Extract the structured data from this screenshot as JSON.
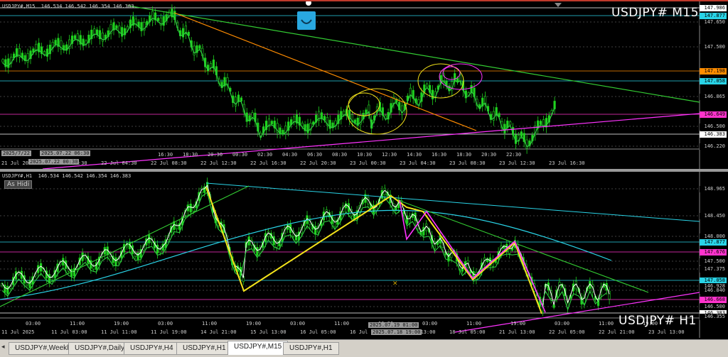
{
  "top_pane": {
    "header": "USDJPY#,M15  146.534 146.542 146.354 146.383",
    "big_label": "USDJPY# M15",
    "price_labels": [
      {
        "text": "147.986",
        "bg": "#ffffff",
        "fg": "#000000"
      },
      {
        "text": "147.877",
        "bg": "#29d3e6",
        "fg": "#000000"
      },
      {
        "text": "147.650",
        "bg": "#000000",
        "fg": "#d0d0d0"
      },
      {
        "text": "147.500",
        "bg": "#000000",
        "fg": "#d0d0d0"
      },
      {
        "text": "147.198",
        "bg": "#ff8c00",
        "fg": "#000000"
      },
      {
        "text": "147.058",
        "bg": "#29d3e6",
        "fg": "#000000"
      },
      {
        "text": "146.865",
        "bg": "#000000",
        "fg": "#d0d0d0"
      },
      {
        "text": "146.649",
        "bg": "#ff33cc",
        "fg": "#000000"
      },
      {
        "text": "146.500",
        "bg": "#000000",
        "fg": "#d0d0d0"
      },
      {
        "text": "146.383",
        "bg": "#ffffff",
        "fg": "#000000"
      },
      {
        "text": "146.220",
        "bg": "#000000",
        "fg": "#d0d0d0"
      }
    ],
    "time_labels": [
      "21 Jul 2025",
      "22 Jul 00:30",
      "22 Jul 04:30",
      "22 Jul 08:30",
      "22 Jul 12:30",
      "22 Jul 16:30",
      "22 Jul 20:30",
      "23 Jul 00:30",
      "23 Jul 04:30",
      "23 Jul 08:30",
      "23 Jul 12:30",
      "23 Jul 16:30"
    ],
    "time_sub": [
      "16:30",
      "18:30",
      "20:30",
      "00:30",
      "02:30",
      "04:30",
      "06:30",
      "08:30",
      "10:30",
      "12:30",
      "14:30",
      "16:30",
      "18:30",
      "20:30",
      "22:30"
    ],
    "date_box_top": "2025/7/22",
    "date_box_a": "2025.07.22 06:30",
    "date_box_b": "2025.07.22 00:30"
  },
  "bottom_pane": {
    "header": "USDJPY#,H1  146.534 146.542 146.354 146.383",
    "big_label": "USDJPY# H1",
    "as_hidi": "As Hidi",
    "price_labels": [
      {
        "text": "148.965",
        "bg": "#000000",
        "fg": "#d0d0d0"
      },
      {
        "text": "148.450",
        "bg": "#000000",
        "fg": "#d0d0d0"
      },
      {
        "text": "148.000",
        "bg": "#000000",
        "fg": "#d0d0d0"
      },
      {
        "text": "147.877",
        "bg": "#29d3e6",
        "fg": "#000000"
      },
      {
        "text": "147.676",
        "bg": "#ff33cc",
        "fg": "#000000"
      },
      {
        "text": "147.500",
        "bg": "#000000",
        "fg": "#d0d0d0"
      },
      {
        "text": "147.375",
        "bg": "#000000",
        "fg": "#d0d0d0"
      },
      {
        "text": "147.058",
        "bg": "#29d3e6",
        "fg": "#000000"
      },
      {
        "text": "146.928",
        "bg": "#000000",
        "fg": "#d0d0d0"
      },
      {
        "text": "146.840",
        "bg": "#000000",
        "fg": "#d0d0d0"
      },
      {
        "text": "146.668",
        "bg": "#ff33cc",
        "fg": "#000000"
      },
      {
        "text": "146.500",
        "bg": "#000000",
        "fg": "#d0d0d0"
      },
      {
        "text": "146.383",
        "bg": "#ffffff",
        "fg": "#000000"
      },
      {
        "text": "146.355",
        "bg": "#000000",
        "fg": "#d0d0d0"
      }
    ],
    "time_labels": [
      "11 Jul 2025",
      "11 Jul 03:00",
      "11 Jul 11:00",
      "11 Jul 19:00",
      "14 Jul 21:00",
      "15 Jul 13:00",
      "16 Jul 05:00",
      "16 Jul 21:00",
      "17 Jul 13:00",
      "18 Jul 05:00",
      "21 Jul 13:00",
      "22 Jul 05:00",
      "22 Jul 21:00",
      "23 Jul 13:00"
    ],
    "time_sub": [
      "03:00",
      "11:00",
      "19:00",
      "03:00",
      "11:00",
      "19:00",
      "03:00",
      "11:00",
      "19:00",
      "03:00",
      "11:00",
      "19:00",
      "03:00",
      "11:00",
      "19:00"
    ],
    "date_box_a": "2025.07.19 01:00",
    "date_box_b": "2025.07.18 19:00",
    "date_box_c": "2025/7/11"
  },
  "tabs": [
    {
      "label": "USDJPY#,Weekly",
      "active": false
    },
    {
      "label": "USDJPY#,Daily",
      "active": false
    },
    {
      "label": "USDJPY#,H4",
      "active": false
    },
    {
      "label": "USDJPY#,H1",
      "active": false
    },
    {
      "label": "USDJPY#,M15",
      "active": true
    },
    {
      "label": "USDJPY#,H1",
      "active": false
    }
  ],
  "colors": {
    "bull": "#1fd11f",
    "ma_green": "#2ecc40",
    "trend_green": "#33cc33",
    "orange": "#ff8c00",
    "magenta": "#ff33ff",
    "yellow": "#f2e21a",
    "cyan": "#29d3e6",
    "white_ma": "#ffffff"
  }
}
